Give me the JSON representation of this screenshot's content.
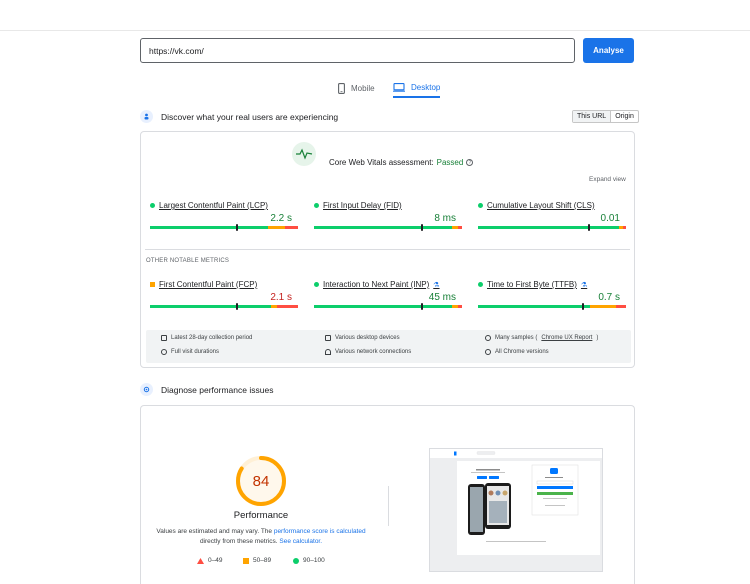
{
  "search": {
    "url_value": "https://vk.com/",
    "analyse_label": "Analyse"
  },
  "tabs": [
    {
      "label": "Mobile"
    },
    {
      "label": "Desktop"
    }
  ],
  "field_section": {
    "title": "Discover what your real users are experiencing",
    "toggle": {
      "this_url": "This URL",
      "origin": "Origin"
    }
  },
  "cwv": {
    "assessment_label": "Core Web Vitals assessment:",
    "assessment_status": "Passed",
    "expand_view": "Expand view",
    "core_metrics": [
      {
        "name": "Largest Contentful Paint (LCP)",
        "value": "2.2 s",
        "status": "good",
        "marker_pct": 0.58
      },
      {
        "name": "First Input Delay (FID)",
        "value": "8 ms",
        "status": "good",
        "marker_pct": 0.72
      },
      {
        "name": "Cumulative Layout Shift (CLS)",
        "value": "0.01",
        "status": "good",
        "marker_pct": 0.74
      }
    ],
    "other_label": "OTHER NOTABLE METRICS",
    "other_metrics": [
      {
        "name": "First Contentful Paint (FCP)",
        "value": "2.1 s",
        "status": "needs-improvement",
        "marker_pct": 0.58
      },
      {
        "name": "Interaction to Next Paint (INP)",
        "value": "45 ms",
        "status": "good",
        "marker_pct": 0.72
      },
      {
        "name": "Time to First Byte (TTFB)",
        "value": "0.7 s",
        "status": "good",
        "marker_pct": 0.7
      }
    ],
    "footer": {
      "collection_period": "Latest 28-day collection period",
      "devices": "Various desktop devices",
      "samples_prefix": "Many samples (",
      "samples_link": "Chrome UX Report",
      "samples_suffix": ")",
      "durations": "Full visit durations",
      "network": "Various network connections",
      "versions": "All Chrome versions"
    }
  },
  "diagnose_section": {
    "title": "Diagnose performance issues"
  },
  "performance": {
    "score": "84",
    "score_fraction": 0.84,
    "label": "Performance",
    "note_1": "Values are estimated and may vary. The ",
    "note_link_1": "performance score is calculated",
    "note_2": " directly from these metrics. ",
    "note_link_2": "See calculator.",
    "legend": [
      {
        "range": "0–49"
      },
      {
        "range": "50–89"
      },
      {
        "range": "90–100"
      }
    ]
  },
  "colors": {
    "accent": "#1a73e8",
    "good": "#0cce6b",
    "average": "#ffa400",
    "poor": "#ff4e42"
  }
}
